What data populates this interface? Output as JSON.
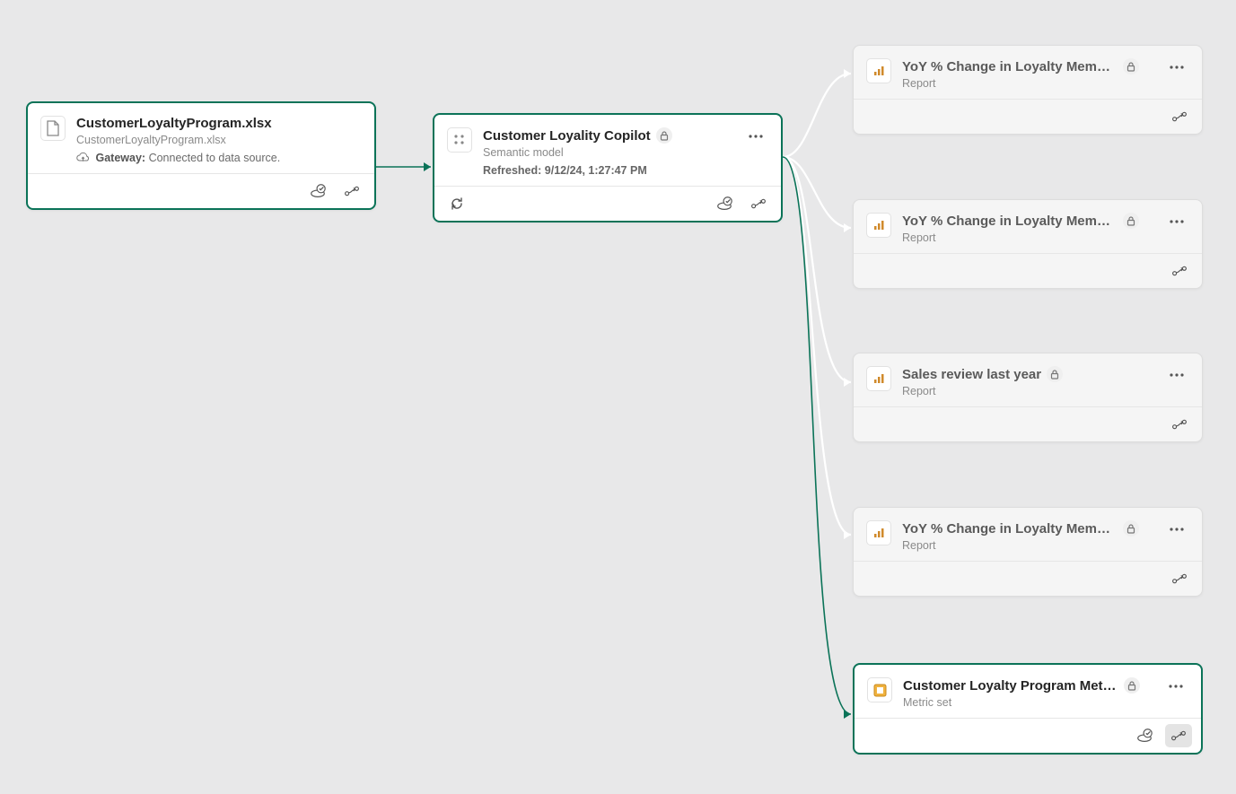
{
  "source": {
    "title": "CustomerLoyaltyProgram.xlsx",
    "subtitle": "CustomerLoyaltyProgram.xlsx",
    "gatewayLabel": "Gateway:",
    "gatewayStatus": "Connected to data source."
  },
  "model": {
    "title": "Customer Loyality Copilot",
    "subtitle": "Semantic model",
    "refreshed": "Refreshed: 9/12/24, 1:27:47 PM"
  },
  "downstream": [
    {
      "title": "YoY % Change in Loyalty Members",
      "type": "Report",
      "faded": true
    },
    {
      "title": "YoY % Change in Loyalty Members",
      "type": "Report",
      "faded": true
    },
    {
      "title": "Sales review last year",
      "type": "Report",
      "faded": true
    },
    {
      "title": "YoY % Change in Loyalty Members",
      "type": "Report",
      "faded": true
    },
    {
      "title": "Customer Loyalty Program Metri…",
      "type": "Metric set",
      "faded": false,
      "selected": true
    }
  ]
}
